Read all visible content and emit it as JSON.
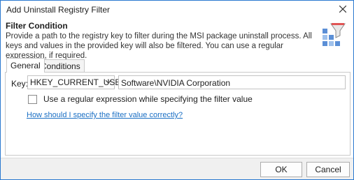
{
  "window": {
    "title": "Add Uninstall Registry Filter"
  },
  "header": {
    "title": "Filter Condition",
    "description": "Provide a path to the registry key to filter during the MSI package uninstall process. All keys and values in the provided key will also be filtered. You can use a regular expression, if required.",
    "icon": "registry-filter-icon"
  },
  "tabs": [
    {
      "label": "General",
      "active": true
    },
    {
      "label": "Conditions",
      "active": false
    }
  ],
  "form": {
    "key_label": "Key:",
    "hive_selected": "HKEY_CURRENT_USER",
    "path_value": "Software\\NVIDIA Corporation",
    "regex_checkbox_label": "Use a regular expression while specifying the filter value",
    "regex_checked": false,
    "help_link": "How should I specify the filter value correctly?"
  },
  "buttons": {
    "ok": "OK",
    "cancel": "Cancel"
  },
  "colors": {
    "accent": "#2b79d0",
    "link": "#1a6fc4",
    "footer_bg": "#f0f0f0"
  }
}
